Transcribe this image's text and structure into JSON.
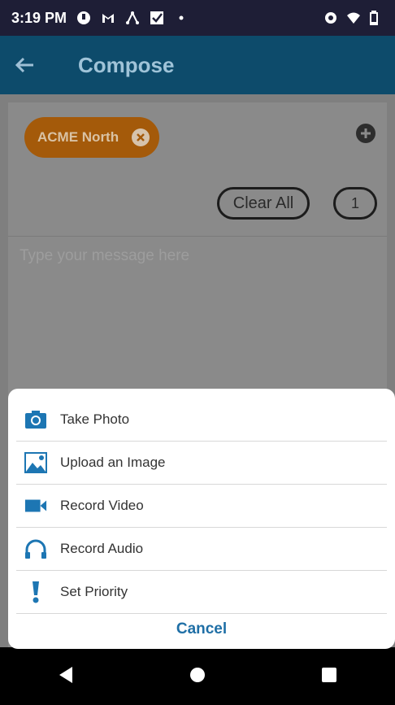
{
  "status_bar": {
    "time": "3:19 PM"
  },
  "app_bar": {
    "title": "Compose"
  },
  "recipients": {
    "chip_label": "ACME North",
    "clear_all_label": "Clear All",
    "count": "1"
  },
  "message": {
    "placeholder": "Type your message here"
  },
  "action_sheet": {
    "items": [
      {
        "label": "Take Photo",
        "icon": "camera-icon"
      },
      {
        "label": "Upload an Image",
        "icon": "image-icon"
      },
      {
        "label": "Record Video",
        "icon": "video-icon"
      },
      {
        "label": "Record Audio",
        "icon": "headphones-icon"
      },
      {
        "label": "Set Priority",
        "icon": "exclamation-icon"
      }
    ],
    "cancel_label": "Cancel"
  },
  "colors": {
    "app_bar": "#0d4b6b",
    "chip": "#a45a0a",
    "accent": "#1f6fa6"
  }
}
